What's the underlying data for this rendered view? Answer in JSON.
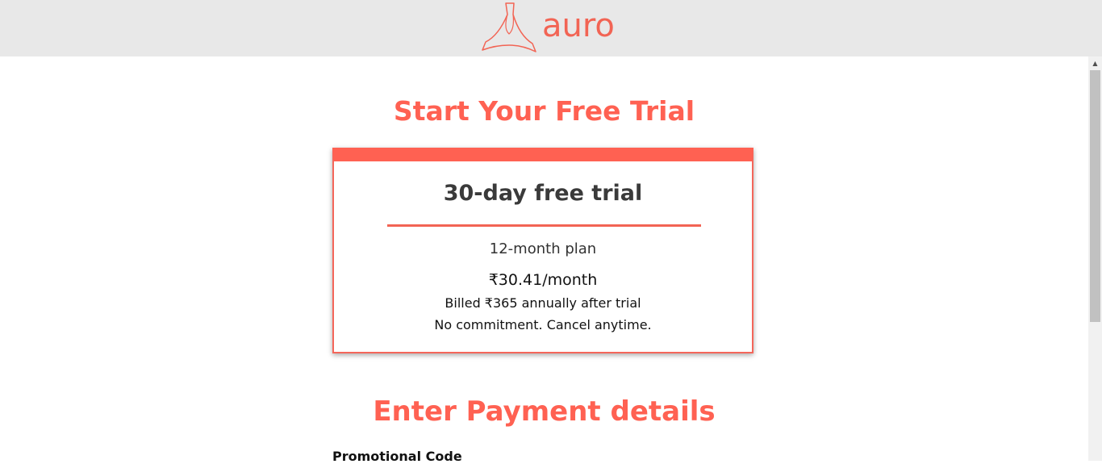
{
  "header": {
    "logo_text": "auro",
    "logo_icon": "auro-triangle-logo-icon"
  },
  "trial_section": {
    "title": "Start Your Free Trial",
    "card": {
      "heading": "30-day free trial",
      "plan": "12-month plan",
      "price": "₹30.41/month",
      "billed": "Billed ₹365 annually after trial",
      "commitment": "No commitment. Cancel anytime."
    }
  },
  "payment_section": {
    "title": "Enter Payment details",
    "promo_label": "Promotional Code"
  },
  "colors": {
    "accent": "#ff6152",
    "header_bg": "#e8e8e8",
    "heading_text": "#3a3a3a"
  }
}
